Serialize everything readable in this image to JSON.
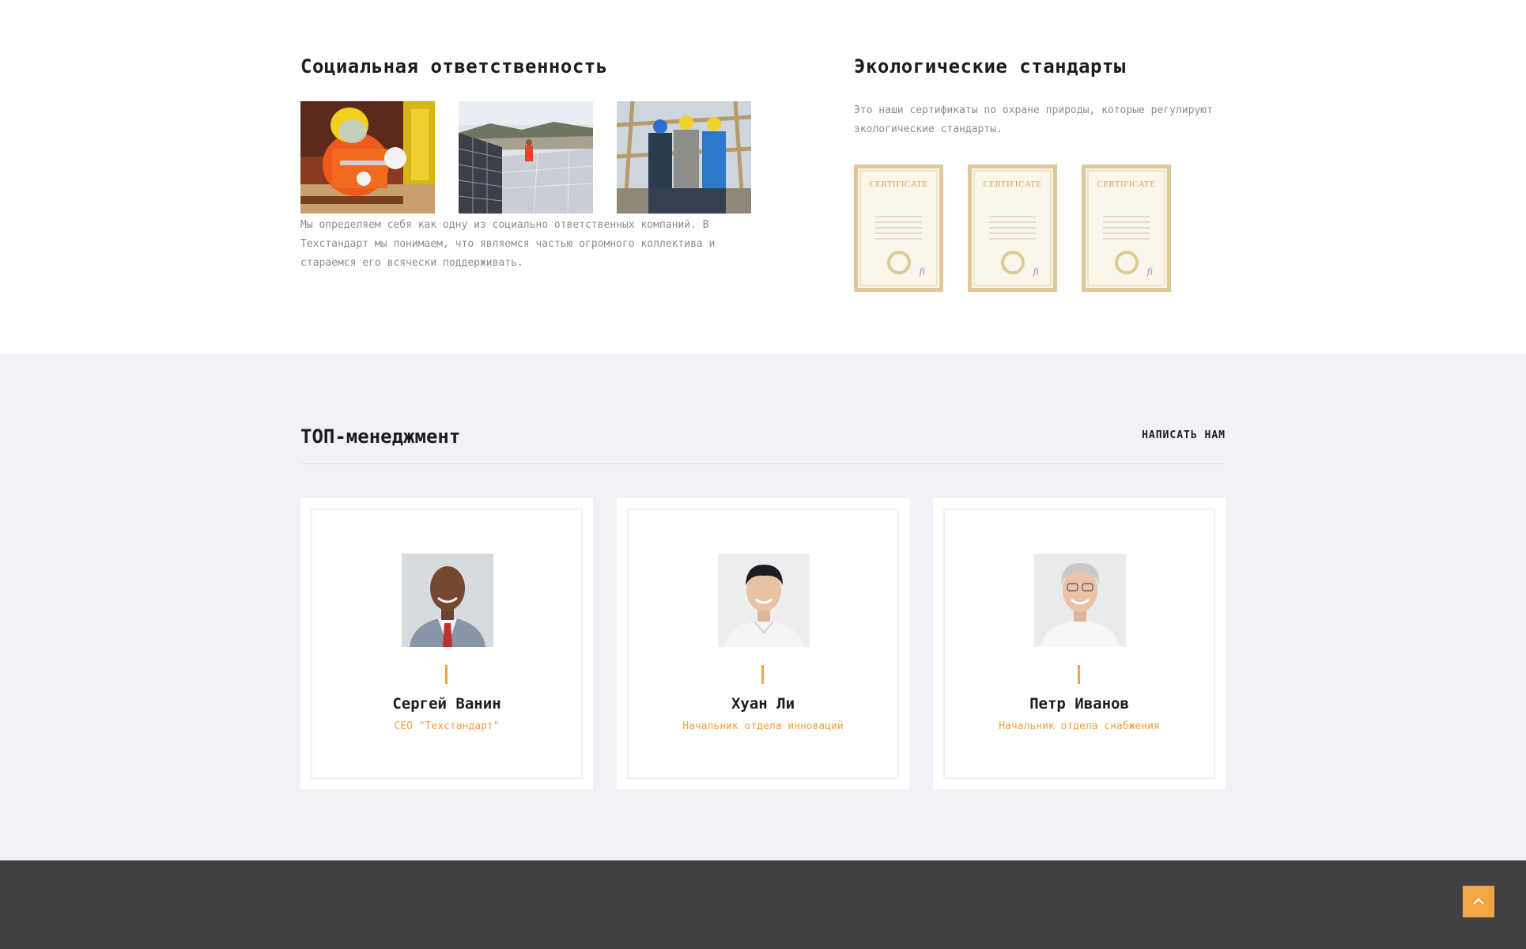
{
  "social": {
    "title": "Социальная ответственность",
    "description": "Мы определяем себя как одну из социально ответственных компаний. В Техстандарт мы понимаем, что являемся частью огромного коллектива и стараемся его всячески поддерживать.",
    "photos": [
      "worker-welding-photo",
      "solar-panel-worker-photo",
      "construction-team-photo"
    ]
  },
  "eco": {
    "title": "Экологические стандарты",
    "description": "Это наши сертификаты по охране природы, которые регулируют экологические стандарты.",
    "certificates": [
      {
        "title": "CERTIFICATE"
      },
      {
        "title": "CERTIFICATE"
      },
      {
        "title": "CERTIFICATE"
      }
    ]
  },
  "management": {
    "title": "ТОП-менеджмент",
    "contact_link": "НАПИСАТЬ НАМ",
    "people": [
      {
        "name": "Сергей Ванин",
        "role": "CEO \"Техстандарт\""
      },
      {
        "name": "Хуан Ли",
        "role": "Начальник отдела инноваций"
      },
      {
        "name": "Петр Иванов",
        "role": "Начальник отдела снабжения"
      }
    ]
  },
  "scroll_top": {
    "icon": "chevron-up-icon"
  },
  "colors": {
    "accent": "#f4a340",
    "footer": "#414141",
    "section_bg": "#f1f2f7"
  }
}
